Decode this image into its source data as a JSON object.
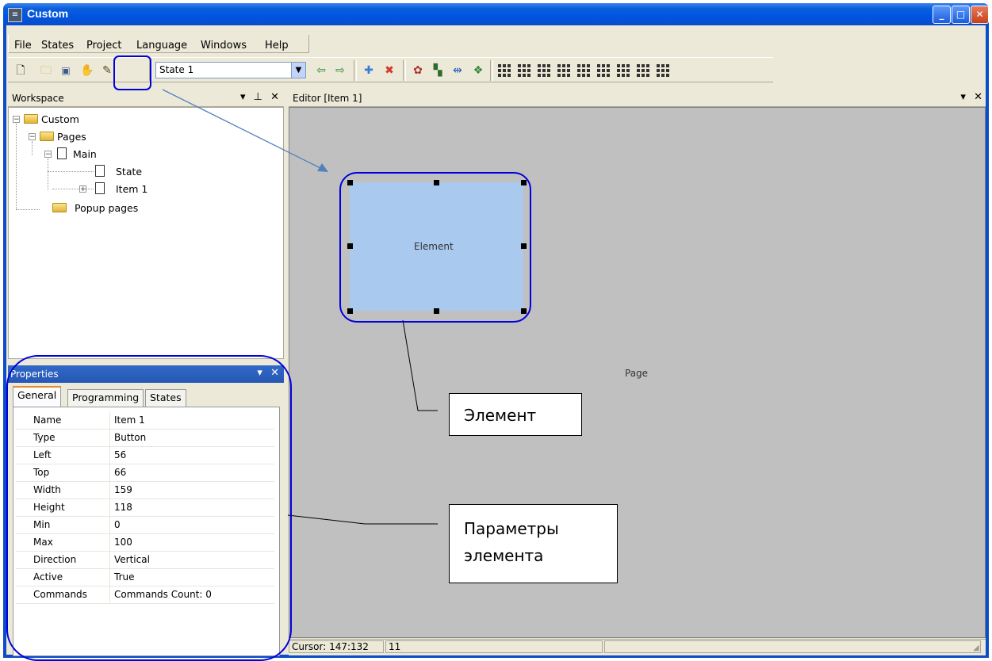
{
  "window": {
    "title": "Custom"
  },
  "menu": [
    "File",
    "States",
    "Project",
    "Language",
    "Windows",
    "Help"
  ],
  "toolbar": {
    "state_value": "State 1"
  },
  "workspace": {
    "title": "Workspace",
    "tree": [
      {
        "label": "Custom",
        "type": "folder"
      },
      {
        "label": "Pages",
        "type": "folder"
      },
      {
        "label": "Main",
        "type": "page"
      },
      {
        "label": "State",
        "type": "doc"
      },
      {
        "label": "Item 1",
        "type": "doc"
      },
      {
        "label": "Popup pages",
        "type": "folder"
      }
    ]
  },
  "properties": {
    "title": "Properties",
    "tabs": [
      "General",
      "Programming",
      "States"
    ],
    "rows": [
      {
        "name": "Name",
        "value": "Item 1"
      },
      {
        "name": "Type",
        "value": "Button"
      },
      {
        "name": "Left",
        "value": "56"
      },
      {
        "name": "Top",
        "value": "66"
      },
      {
        "name": "Width",
        "value": "159"
      },
      {
        "name": "Height",
        "value": "118"
      },
      {
        "name": "Min",
        "value": "0"
      },
      {
        "name": "Max",
        "value": "100"
      },
      {
        "name": "Direction",
        "value": "Vertical"
      },
      {
        "name": "Active",
        "value": "True"
      },
      {
        "name": "Commands",
        "value": "Commands Count: 0"
      }
    ]
  },
  "editor": {
    "title": "Editor [Item 1]",
    "element_label": "Element",
    "page_label": "Page"
  },
  "status": {
    "cursor": "Cursor: 147:132",
    "value": "11"
  },
  "annotations": {
    "element": "Элемент",
    "params_line1": "Параметры",
    "params_line2": "элемента"
  },
  "colors": {
    "titlebar": "#0054e3",
    "annotation_outline": "#0000dd",
    "element_fill": "#a9c9ee"
  }
}
